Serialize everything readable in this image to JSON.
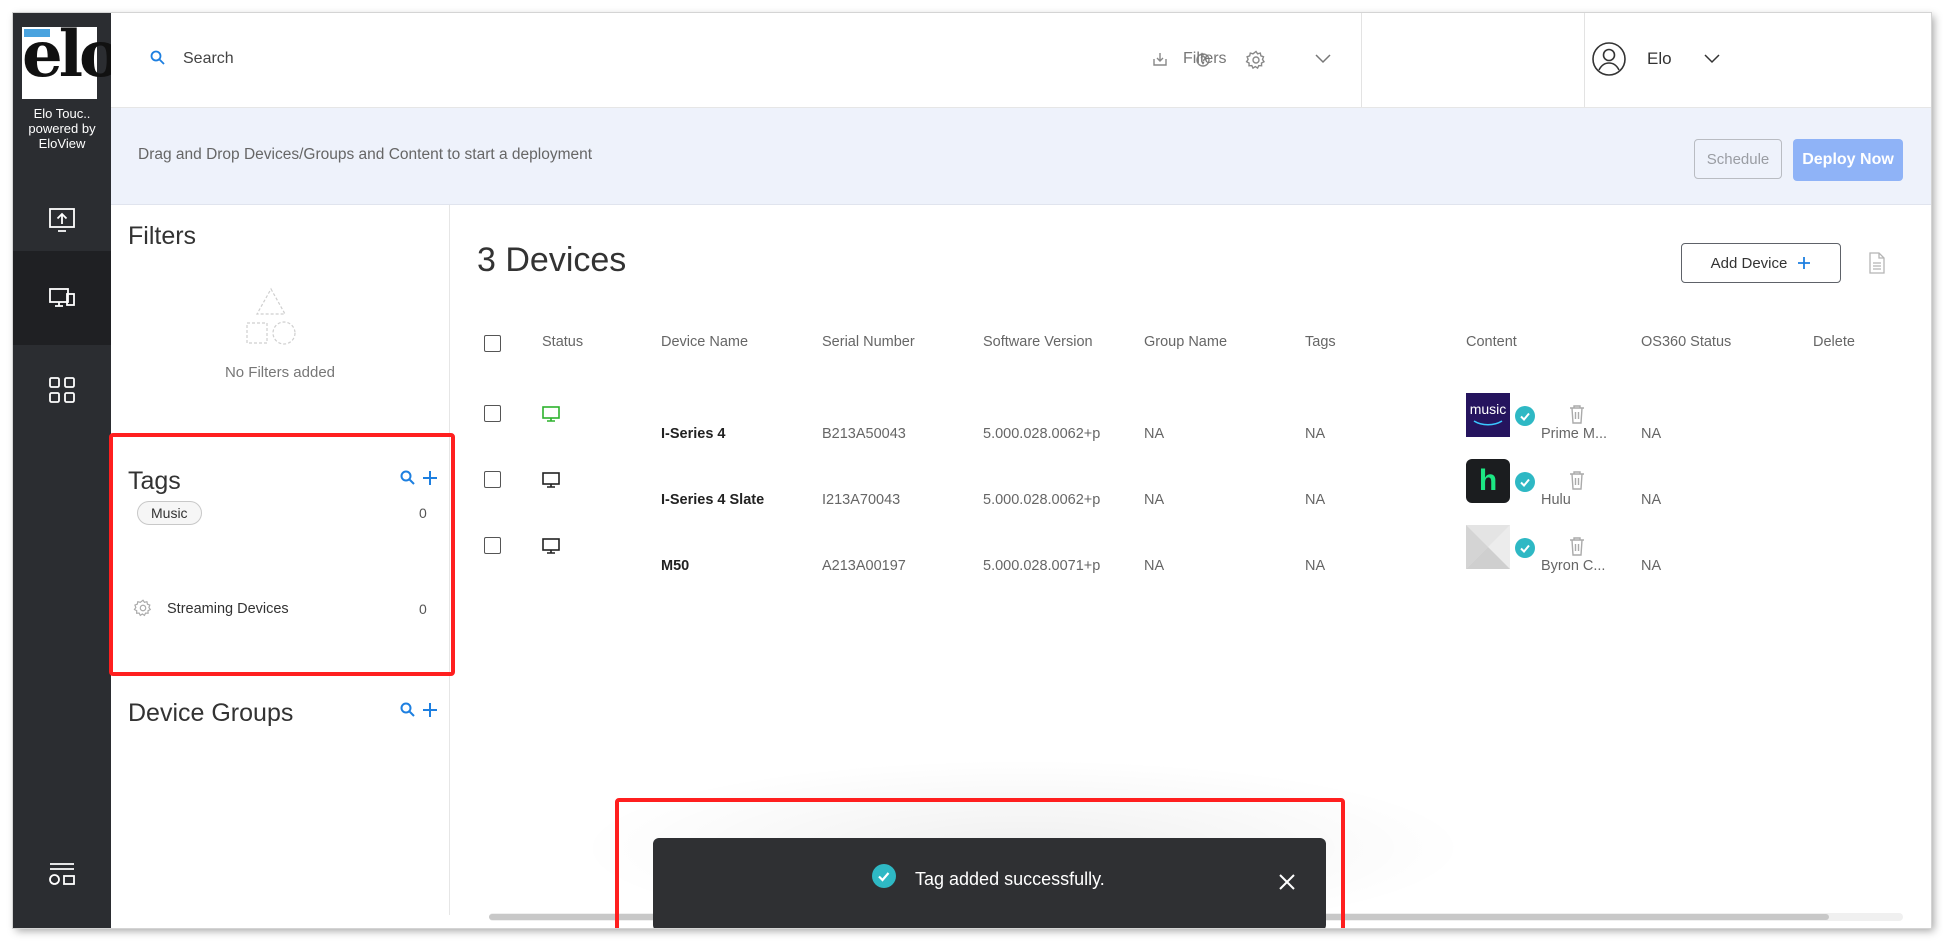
{
  "app": {
    "logo_text": "elo",
    "brand_line1": "Elo Touc..",
    "brand_line2": "powered by",
    "brand_line3": "EloView"
  },
  "topbar": {
    "search_placeholder": "Search",
    "filters_label": "Filters",
    "user_name": "Elo"
  },
  "deploy": {
    "hint": "Drag and Drop Devices/Groups and Content to start a deployment",
    "schedule_label": "Schedule",
    "deploy_label": "Deploy Now"
  },
  "side": {
    "filters_title": "Filters",
    "no_filters": "No Filters added",
    "tags_title": "Tags",
    "tags": [
      {
        "label": "Music",
        "count": "0"
      }
    ],
    "groups_title": "Device Groups",
    "groups": [
      {
        "label": "Streaming Devices",
        "count": "0"
      }
    ]
  },
  "main": {
    "title": "3 Devices",
    "add_device_label": "Add Device",
    "columns": [
      "Status",
      "Device Name",
      "Serial Number",
      "Software Version",
      "Group Name",
      "Tags",
      "Content",
      "OS360 Status",
      "Delete"
    ],
    "rows": [
      {
        "status": "online",
        "name": "I-Series 4",
        "serial": "B213A50043",
        "version": "5.000.028.0062+p",
        "group": "NA",
        "tags": "NA",
        "content_icon": "music",
        "content": "Prime M...",
        "os360": "NA"
      },
      {
        "status": "offline",
        "name": "I-Series 4 Slate",
        "serial": "I213A70043",
        "version": "5.000.028.0062+p",
        "group": "NA",
        "tags": "NA",
        "content_icon": "h",
        "content": "Hulu",
        "os360": "NA"
      },
      {
        "status": "offline",
        "name": "M50",
        "serial": "A213A00197",
        "version": "5.000.028.0071+p",
        "group": "NA",
        "tags": "NA",
        "content_icon": "placeholder-image",
        "content": "Byron C...",
        "os360": "NA"
      }
    ]
  },
  "toast": {
    "message": "Tag added successfully."
  },
  "colors": {
    "rail": "#2b2d31",
    "accent": "#1d7fe0",
    "online": "#2db22d",
    "success": "#2eb8c4",
    "highlight": "#ff1f1f",
    "deploy_btn": "#8fb3f7"
  }
}
